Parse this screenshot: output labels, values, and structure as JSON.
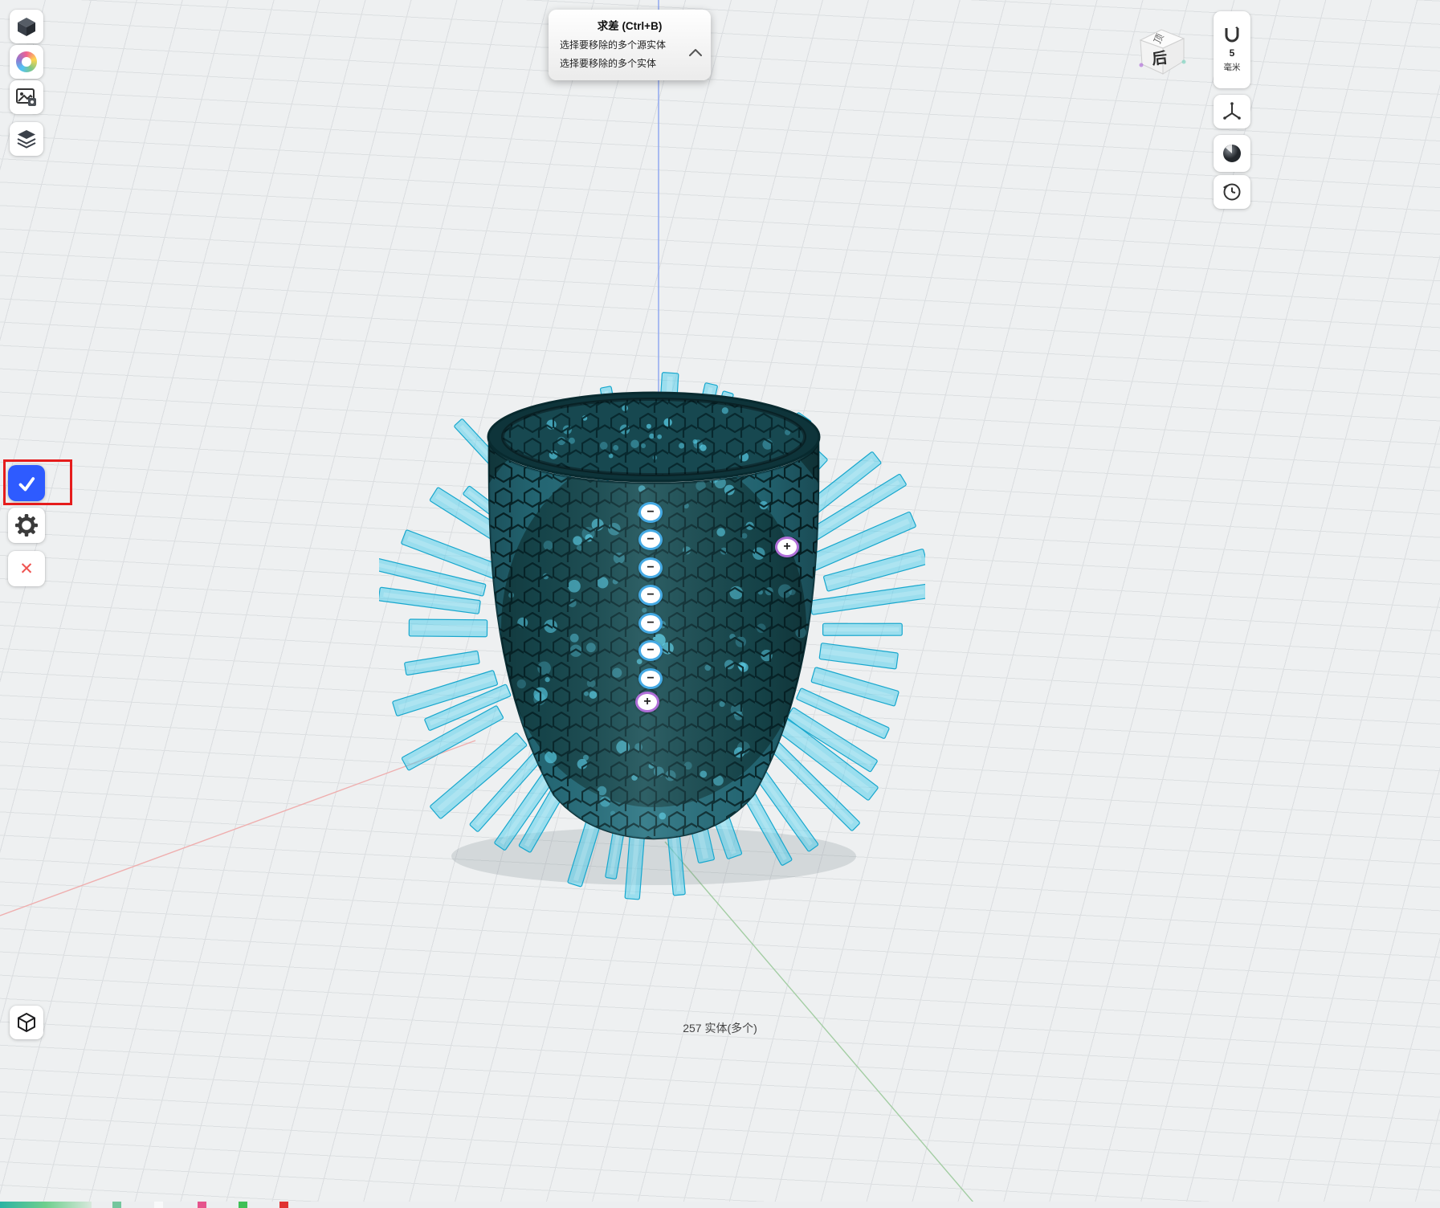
{
  "tooltip": {
    "title": "求差 (Ctrl+B)",
    "line1": "选择要移除的多个源实体",
    "line2": "选择要移除的多个实体"
  },
  "icons": {
    "minus": "−",
    "plus": "+",
    "close": "✕",
    "check": "✓"
  },
  "right_toolbar": {
    "grid_value": "5",
    "grid_unit": "毫米"
  },
  "view_cube": {
    "back_label": "后",
    "top_label": "顶"
  },
  "status_bar": {
    "entities": "257 实体(多个)"
  },
  "colors": {
    "accent_blue": "#2e5bff",
    "annotation_red": "#e51c1c",
    "ring_blue": "#45aae4",
    "ring_purple": "#b06fd8",
    "body_teal": "#17494f",
    "lattice": "#06262b",
    "spike_fill": "rgba(72,203,235,0.50)",
    "spike_stroke": "#18a7cd",
    "halo": "rgba(80,210,240,0.28)",
    "dot": "95,220,248"
  }
}
